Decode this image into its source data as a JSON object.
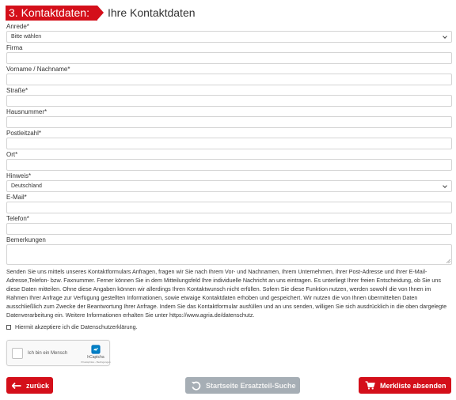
{
  "header": {
    "step_badge": "3. Kontaktdaten:",
    "title": "Ihre Kontaktdaten"
  },
  "form": {
    "anrede": {
      "label": "Anrede*",
      "value": "Bitte wählen"
    },
    "firma": {
      "label": "Firma",
      "value": ""
    },
    "name": {
      "label": "Vorname / Nachname*",
      "value": ""
    },
    "strasse": {
      "label": "Straße*",
      "value": ""
    },
    "hausnummer": {
      "label": "Hausnummer*",
      "value": ""
    },
    "postleitzahl": {
      "label": "Postleitzahl*",
      "value": ""
    },
    "ort": {
      "label": "Ort*",
      "value": ""
    },
    "land": {
      "label": "Hinweis*",
      "value": "Deutschland"
    },
    "email": {
      "label": "E-Mail*",
      "value": ""
    },
    "telefon": {
      "label": "Telefon*",
      "value": ""
    },
    "bemerkungen": {
      "label": "Bemerkungen",
      "value": ""
    }
  },
  "privacy_text": "Senden Sie uns mittels unseres Kontaktformulars Anfragen, fragen wir Sie nach Ihrem Vor- und Nachnamen, Ihrem Unternehmen, Ihrer Post-Adresse und Ihrer E-Mail-Adresse,Telefon- bzw. Faxnummer. Ferner können Sie in dem Mitteilungsfeld Ihre individuelle Nachricht an uns eintragen. Es unterliegt Ihrer freien Entscheidung, ob Sie uns diese Daten mitteilen. Ohne diese Angaben können wir allerdings Ihren Kontaktwunsch nicht erfüllen. Sofern Sie diese Funktion nutzen, werden sowohl die von Ihnen im Rahmen Ihrer Anfrage zur Verfügung gestellten Informationen, sowie etwaige Kontaktdaten erhoben und gespeichert. Wir nutzen die von Ihnen übermittelten Daten ausschließlich zum Zwecke der Beantwortung Ihrer Anfrage. Indem Sie das Kontaktformular ausfüllen und an uns senden, willigen Sie sich ausdrücklich in die oben dargelegte Datenverarbeitung ein. Weitere Informationen erhalten Sie unter https://www.agria.de/datenschutz.",
  "consent": {
    "label": "Hiermit akzeptiere ich die Datenschutzerklärung."
  },
  "captcha": {
    "label": "Ich bin ein Mensch",
    "brand": "hCaptcha",
    "links": "Privatsphäre - Bedingungen",
    "icon": "hcaptcha-logo-icon"
  },
  "buttons": {
    "back": "zurück",
    "restart": "Startseite Ersatzteil-Suche",
    "wishlist": "Merkliste absenden"
  },
  "colors": {
    "accent": "#d40f1a",
    "disabled_button": "#a6aeb5",
    "input_border": "#d4d4d4"
  }
}
